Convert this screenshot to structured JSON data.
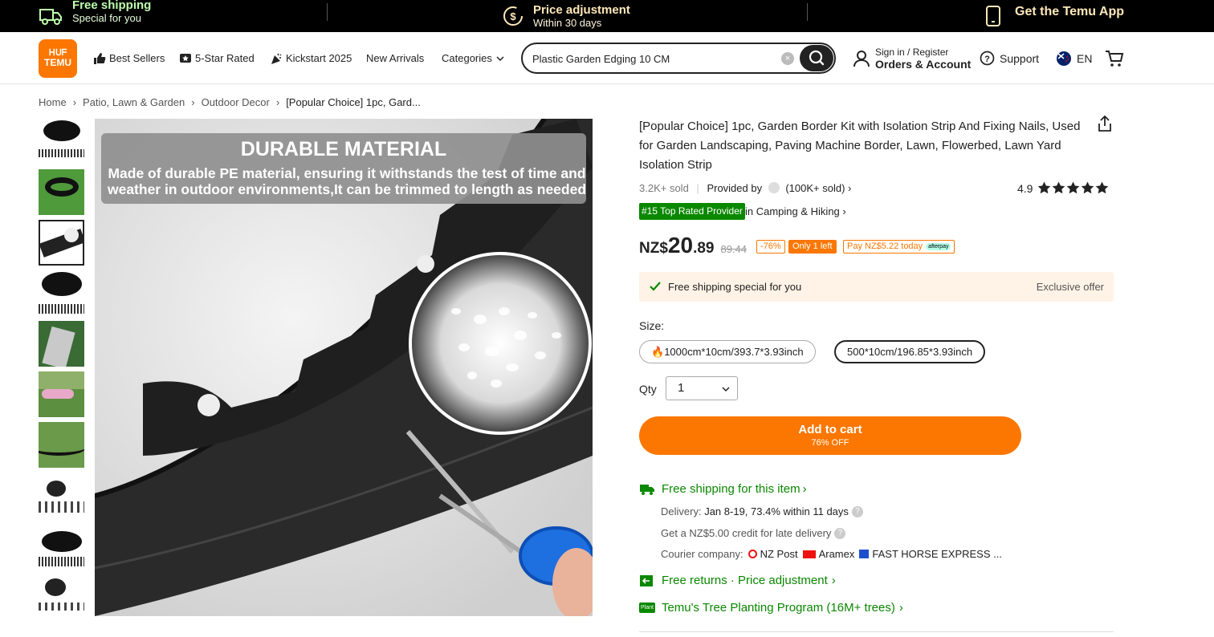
{
  "promo": {
    "free_shipping_title": "Free shipping",
    "free_shipping_sub": "Special for you",
    "price_adj_title": "Price adjustment",
    "price_adj_sub": "Within 30 days",
    "app_label": "Get the Temu App"
  },
  "header": {
    "logo_line1": "ᕼᑌᖴ",
    "logo_line2": "TEMU",
    "nav": [
      {
        "label": "Best Sellers",
        "icon": "thumbs-up-icon"
      },
      {
        "label": "5-Star Rated",
        "icon": "star-badge-icon"
      },
      {
        "label": "Kickstart 2025",
        "icon": "party-popper-icon"
      },
      {
        "label": "New Arrivals"
      },
      {
        "label": "Categories",
        "icon": "chevron-down-icon"
      }
    ],
    "search_value": "Plastic Garden Edging 10 CM",
    "signin_small": "Sign in / Register",
    "signin_big": "Orders & Account",
    "support": "Support",
    "lang": "EN"
  },
  "breadcrumb": [
    "Home",
    "Patio, Lawn & Garden",
    "Outdoor Decor",
    "[Popular Choice] 1pc, Gard..."
  ],
  "gallery": {
    "headline": "DURABLE MATERIAL",
    "body": "Made of durable PE material, ensuring it withstands the test of time and weather in outdoor environments,It can be trimmed to length as needed"
  },
  "product": {
    "title": "[Popular Choice] 1pc, Garden Border Kit with Isolation Strip And Fixing Nails, Used for Garden Landscaping, Paving Machine Border, Lawn, Flowerbed, Lawn Yard Isolation Strip",
    "sold": "3.2K+ sold",
    "provided_by": "Provided by",
    "provider_sold": "(100K+ sold)",
    "rating": "4.9",
    "rating_value": 4.9,
    "top_rated": "#15 Top Rated Provider",
    "top_rated_cat": "in Camping & Hiking",
    "currency": "NZ$",
    "price_int": "20",
    "price_dec": ".89",
    "original_price": "89.44",
    "discount": "-76%",
    "stock": "Only 1 left",
    "pay_today": "Pay NZ$5.22 today",
    "pay_brand": "afterpay",
    "shipping_notice": "Free shipping special for you",
    "exclusive": "Exclusive offer",
    "size_label": "Size:",
    "sizes": [
      "1000cm*10cm/393.7*3.93inch",
      "500*10cm/196.85*3.93inch"
    ],
    "selected_size": "500*10cm/196.85*3.93inch",
    "qty_label": "Qty",
    "qty_value": "1",
    "cart_label": "Add to cart",
    "cart_sub": "76% OFF",
    "free_ship_item": "Free shipping for this item",
    "delivery_label": "Delivery:",
    "delivery_value": "Jan 8-19, 73.4% within 11 days",
    "credit": "Get a NZ$5.00 credit for late delivery",
    "courier_label": "Courier company:",
    "couriers": [
      "NZ Post",
      "Aramex",
      "FAST HORSE EXPRESS ..."
    ],
    "returns": "Free returns · Price adjustment",
    "tree": "Temu's Tree Planting Program (16M+ trees)",
    "tree_badge": "Plant"
  },
  "colors": {
    "accent": "#fb7701",
    "green": "#0a8800",
    "dark": "#222222"
  }
}
